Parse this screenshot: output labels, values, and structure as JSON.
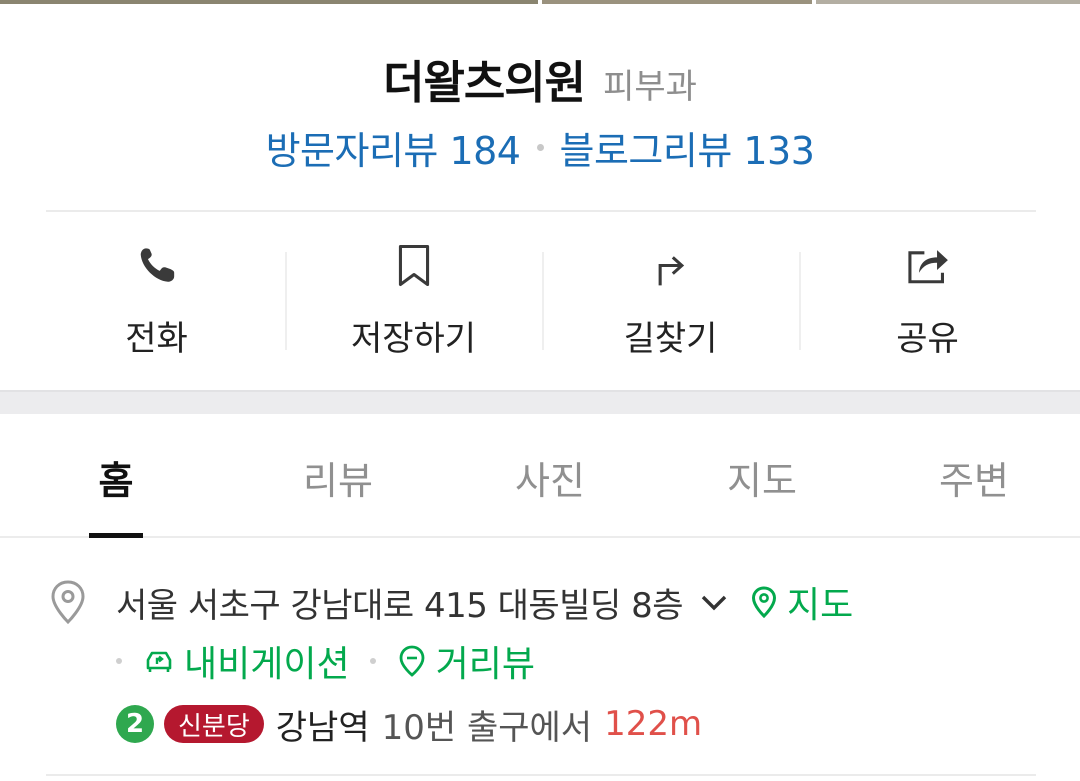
{
  "place": {
    "name": "더왈츠의원",
    "category": "피부과"
  },
  "reviews": {
    "visitor": "방문자리뷰 184",
    "blog": "블로그리뷰 133"
  },
  "actions": [
    {
      "label": "전화",
      "icon": "phone-icon"
    },
    {
      "label": "저장하기",
      "icon": "bookmark-icon"
    },
    {
      "label": "길찾기",
      "icon": "directions-icon"
    },
    {
      "label": "공유",
      "icon": "share-icon"
    }
  ],
  "tabs": [
    {
      "label": "홈",
      "active": true
    },
    {
      "label": "리뷰",
      "active": false
    },
    {
      "label": "사진",
      "active": false
    },
    {
      "label": "지도",
      "active": false
    },
    {
      "label": "주변",
      "active": false
    }
  ],
  "address": {
    "text": "서울 서초구 강남대로 415 대동빌딩 8층",
    "map_link": "지도",
    "navigation_link": "내비게이션",
    "street_view_link": "거리뷰"
  },
  "subway": {
    "line_number": "2",
    "line_badge": "신분당",
    "station": "강남역",
    "exit": "10번 출구에서",
    "distance": "122m"
  },
  "colors": {
    "link_blue": "#1b6db5",
    "green": "#03a94d",
    "line2_green": "#2fa84f",
    "shinbundang_red": "#b5182f",
    "distance_red": "#e0504a"
  }
}
